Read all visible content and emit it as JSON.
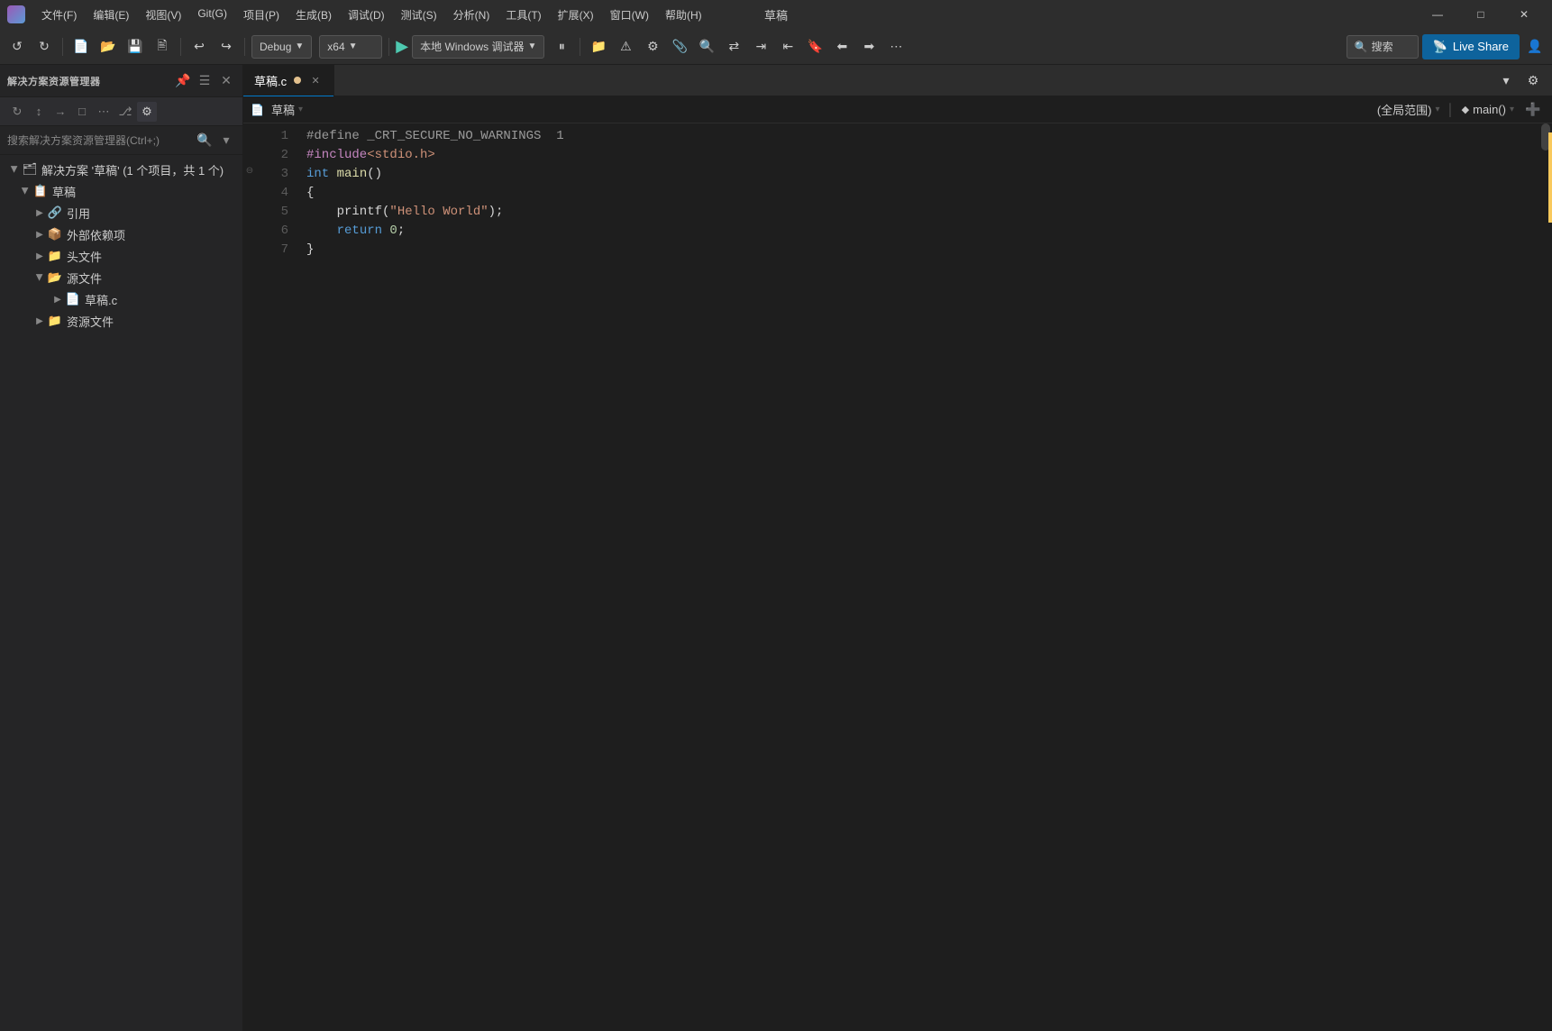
{
  "titleBar": {
    "title": "草稿",
    "menus": [
      "文件(F)",
      "编辑(E)",
      "视图(V)",
      "Git(G)",
      "项目(P)",
      "生成(B)",
      "调试(D)",
      "测试(S)",
      "分析(N)",
      "工具(T)",
      "扩展(X)",
      "窗口(W)",
      "帮助(H)"
    ]
  },
  "toolbar": {
    "debugConfig": "Debug",
    "platform": "x64",
    "localDebug": "本地 Windows 调试器",
    "search": "搜索",
    "liveShare": "Live Share"
  },
  "sidebar": {
    "title": "解决方案资源管理器",
    "searchPlaceholder": "搜索解决方案资源管理器(Ctrl+;)",
    "solutionLabel": "解决方案 '草稿' (1 个项目，共 1 个)",
    "items": [
      {
        "label": "草稿",
        "type": "project",
        "open": true,
        "indent": 1
      },
      {
        "label": "引用",
        "type": "folder",
        "open": false,
        "indent": 2
      },
      {
        "label": "外部依赖项",
        "type": "folder",
        "open": false,
        "indent": 2
      },
      {
        "label": "头文件",
        "type": "folder",
        "open": false,
        "indent": 2
      },
      {
        "label": "源文件",
        "type": "folder",
        "open": true,
        "indent": 2
      },
      {
        "label": "草稿.c",
        "type": "file",
        "open": false,
        "indent": 3
      },
      {
        "label": "资源文件",
        "type": "folder",
        "open": false,
        "indent": 2
      }
    ]
  },
  "editor": {
    "tabLabel": "草稿.c",
    "tabModified": true,
    "breadcrumb": "草稿",
    "scope": "(全局范围)",
    "function": "main()",
    "lines": [
      {
        "num": 1,
        "tokens": [
          {
            "t": "#define _CRT_SECURE_NO_WARNINGS  1",
            "c": "pp"
          }
        ]
      },
      {
        "num": 2,
        "tokens": [
          {
            "t": "#include",
            "c": "inc"
          },
          {
            "t": "<stdio.h>",
            "c": "str"
          }
        ]
      },
      {
        "num": 3,
        "tokens": [
          {
            "t": "int ",
            "c": "kw"
          },
          {
            "t": "main",
            "c": "fn"
          },
          {
            "t": "()",
            "c": "punc"
          }
        ]
      },
      {
        "num": 4,
        "tokens": [
          {
            "t": "{",
            "c": "punc"
          }
        ]
      },
      {
        "num": 5,
        "tokens": [
          {
            "t": "    printf",
            "c": "plain"
          },
          {
            "t": "(",
            "c": "punc"
          },
          {
            "t": "\"Hello World\"",
            "c": "str"
          },
          {
            "t": ");",
            "c": "punc"
          }
        ]
      },
      {
        "num": 6,
        "tokens": [
          {
            "t": "    return ",
            "c": "kw"
          },
          {
            "t": "0",
            "c": "num"
          },
          {
            "t": ";",
            "c": "punc"
          }
        ]
      },
      {
        "num": 7,
        "tokens": [
          {
            "t": "}",
            "c": "punc"
          }
        ]
      }
    ]
  }
}
